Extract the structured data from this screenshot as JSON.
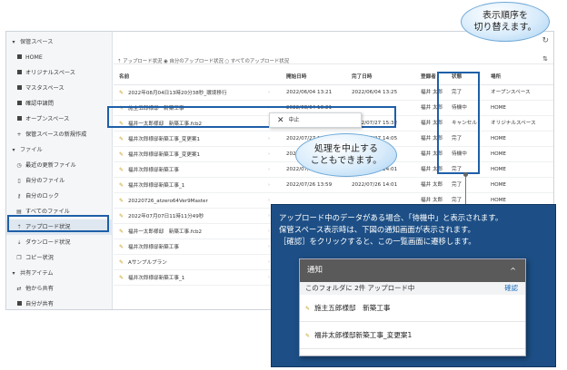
{
  "sidebar": {
    "section1": "保管スペース",
    "items1": [
      "HOME",
      "オリジナルスペース",
      "マスタスペース",
      "確認中諸問",
      "オープンスペース",
      "保管スペースの新規作成"
    ],
    "section2": "ファイル",
    "items2": [
      "最近の更新ファイル",
      "自分のファイル",
      "自分のロック",
      "すべてのファイル",
      "アップロード状況",
      "ダウンロード状況",
      "コピー状況"
    ],
    "section3": "共有アイテム",
    "items3": [
      "他から共有",
      "自分が共有"
    ]
  },
  "toolbar": {
    "filter": "アップロード状況 ◉ 自分のアップロード状況 ○ すべてのアップロード状況"
  },
  "table": {
    "headers": [
      "名前",
      "開始日時",
      "完了日時",
      "登録者",
      "状態",
      "場所"
    ],
    "rows": [
      [
        "2022年08月04日13時20分38秒_環境移行",
        "2022/06/04 13:21",
        "2022/06/04 13:25",
        "福井 太郎",
        "完了",
        "オープンスペース"
      ],
      [
        "施主五郎様邸　新築工事",
        "2022/08/04 13:21",
        "",
        "福井 太郎",
        "待機中",
        "HOME"
      ],
      [
        "福井一太郎様邸　新築工事.fcb2",
        "2022/07/27 15:30",
        "2022/07/27 15:32",
        "福井 太郎",
        "キャンセル",
        "オリジナルスペース"
      ],
      [
        "福井次郎様邸新築工事_変更案1",
        "2022/07/27 14:02",
        "2022/07/27 14:05",
        "福井 太郎",
        "完了",
        "HOME"
      ],
      [
        "福井次郎様邸新築工事_変更案1",
        "2022/07/27 14:01",
        "",
        "福井 太郎",
        "待機中",
        "HOME"
      ],
      [
        "福井次郎様邸新築工事",
        "2022/07/26 14:00",
        "2022/07/26 14:01",
        "福井 太郎",
        "完了",
        "HOME"
      ],
      [
        "福井次郎様邸新築工事_1",
        "2022/07/26 13:59",
        "2022/07/26 14:01",
        "福井 太郎",
        "完了",
        "HOME"
      ],
      [
        "20220726_atzero64Ver9Master",
        "",
        "",
        "福井 太郎",
        "完了",
        "HOME"
      ],
      [
        "2022年07月07日11時11分49秒",
        "",
        "",
        "福井 太郎",
        "完了",
        "HOME"
      ],
      [
        "福井一太郎様邸　新築工事.fcb2",
        "",
        "",
        "福井 太郎",
        "完了",
        "HOME"
      ],
      [
        "福井次郎様邸新築工事",
        "",
        "",
        "福井 太郎",
        "完了",
        "HOME"
      ],
      [
        "Aサンプルプラン",
        "",
        "",
        "福井 太郎",
        "完了",
        "HOME"
      ],
      [
        "福井次郎様邸新築工事_1",
        "",
        "",
        "福井 太郎",
        "完了",
        "HOME"
      ]
    ]
  },
  "context_menu": {
    "cancel": "中止"
  },
  "callouts": {
    "sort": "表示順序を\n切り替えます。",
    "cancel": "処理を中止する\nこともできます。"
  },
  "info": {
    "line1": "アップロード中のデータがある場合、「待機中」と表示されます。",
    "line2": "保管スペース表示時は、下図の通知画面が表示されます。",
    "line3": "［確認］をクリックすると、この一覧画面に遷移します。"
  },
  "notification": {
    "title": "通知",
    "summary": "このフォルダに 2件 アップロード中",
    "confirm": "確認",
    "items": [
      "施主五郎様邸　新築工事",
      "福井太郎様邸新築工事_変更案1"
    ]
  }
}
